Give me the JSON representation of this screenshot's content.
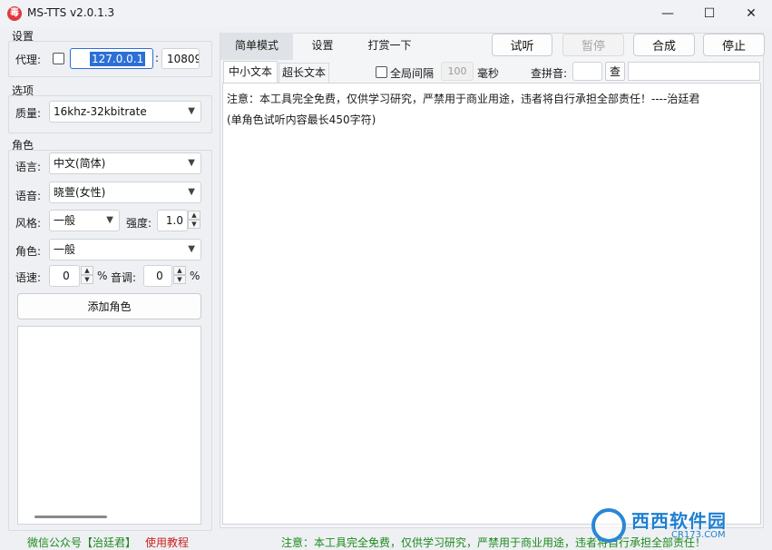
{
  "window": {
    "title": "MS-TTS v2.0.1.3",
    "app_icon_glyph": "毒"
  },
  "titlebar": {
    "min_glyph": "—",
    "max_glyph": "☐",
    "close_glyph": "✕"
  },
  "settings": {
    "label": "设置",
    "proxy_label": "代理:",
    "proxy_host": "127.0.0.1",
    "colon": ":",
    "proxy_port": "10809"
  },
  "options": {
    "label": "选项",
    "quality_label": "质量:",
    "quality_value": "16khz-32kbitrate"
  },
  "role": {
    "label": "角色",
    "language_label": "语言:",
    "language_value": "中文(简体)",
    "voice_label": "语音:",
    "voice_value": "晓萱(女性)",
    "style_label": "风格:",
    "style_value": "一般",
    "intensity_label": "强度:",
    "intensity_value": "1.0",
    "role_label": "角色:",
    "role_value": "一般",
    "speed_label": "语速:",
    "speed_value": "0",
    "pitch_label": "音调:",
    "pitch_value": "0",
    "percent": "%",
    "add_role_button": "添加角色"
  },
  "main_tabs": [
    "简单模式",
    "设置",
    "打赏一下"
  ],
  "actions": {
    "preview": "试听",
    "pause": "暂停",
    "synthesize": "合成",
    "stop": "停止"
  },
  "sub_tabs": [
    "中小文本",
    "超长文本"
  ],
  "global_interval": {
    "label": "全局间隔",
    "value": "100",
    "unit": "毫秒"
  },
  "pinyin": {
    "label": "查拼音:",
    "input_value": "",
    "button": "查",
    "result_value": ""
  },
  "editor": {
    "line1": "注意：本工具完全免费，仅供学习研究，严禁用于商业用途，违者将自行承担全部责任！----治廷君",
    "line2": "(单角色试听内容最长450字符)"
  },
  "footer": {
    "wechat": "微信公众号【治廷君】",
    "tutorial": "使用教程",
    "notice": "注意：本工具完全免费，仅供学习研究，严禁用于商业用途，违者将自行承担全部责任！"
  },
  "watermark": {
    "text": "西西软件园",
    "sub": "CR173.COM"
  },
  "colors": {
    "accent_selection": "#2c6fd6",
    "footer_green": "#1d8a1d",
    "footer_red": "#cc2222",
    "icon_red": "#e0383e"
  }
}
